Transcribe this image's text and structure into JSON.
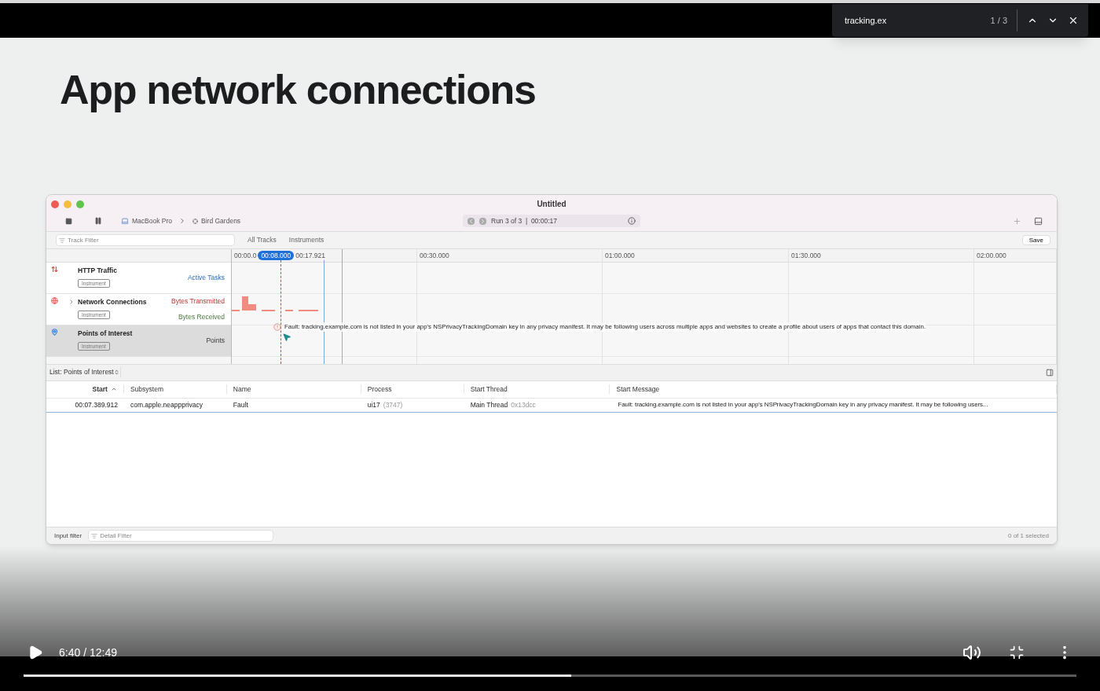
{
  "find_bar": {
    "query": "tracking.ex",
    "count": "1 / 3"
  },
  "slide": {
    "title": "App network connections",
    "window": {
      "title": "Untitled",
      "device": "MacBook Pro",
      "target": "Bird Gardens",
      "run": "Run 3 of 3  |  00:00:17",
      "track_filter": {
        "placeholder": "Track Filter"
      },
      "scopes": [
        "All Tracks",
        "Instruments"
      ],
      "save": "Save",
      "ruler": {
        "start": "00:00.0",
        "cursor": "00:08.000",
        "end": "00:17.921",
        "marks": [
          "00:30.000",
          "01:00.000",
          "01:30.000",
          "02:00.000"
        ]
      },
      "tracks": [
        {
          "name": "HTTP Traffic",
          "kind": "http",
          "badge": "Instrument",
          "expandable": false,
          "selected": false,
          "labels": [
            {
              "text": "Active Tasks",
              "kind": "tasks"
            }
          ]
        },
        {
          "name": "Network Connections",
          "kind": "network",
          "badge": "Instrument",
          "expandable": true,
          "selected": false,
          "labels": [
            {
              "text": "Bytes Transmitted",
              "kind": "transmitted"
            },
            {
              "text": "Bytes Received",
              "kind": "received"
            }
          ]
        },
        {
          "name": "Points of Interest",
          "kind": "poi",
          "badge": "Instrument",
          "expandable": false,
          "selected": true,
          "labels": [
            {
              "text": "Points",
              "kind": "points"
            }
          ]
        }
      ],
      "fault_message": "Fault: tracking.example.com is not listed in your app's NSPrivacyTrackingDomain key in any privacy manifest. It may be following users across multiple apps and websites to create a profile about users of apps that contact this domain.",
      "list": {
        "title": "List: Points of Interest",
        "columns": [
          {
            "label": "Start",
            "sorted": true
          },
          {
            "label": "Subsystem",
            "sorted": false
          },
          {
            "label": "Name",
            "sorted": false
          },
          {
            "label": "Process",
            "sorted": false
          },
          {
            "label": "Start Thread",
            "sorted": false
          },
          {
            "label": "Start Message",
            "sorted": false
          }
        ],
        "rows": [
          {
            "cells": [
              {
                "text": "00:07.389.912"
              },
              {
                "text": "com.apple.neappprivacy"
              },
              {
                "text": "Fault"
              },
              {
                "text": "ui17",
                "detail": "(3747)"
              },
              {
                "text": "Main Thread",
                "detail": "0x13dcc"
              },
              {
                "text": "Fault: tracking.example.com is not listed in your app's NSPrivacyTrackingDomain key in any privacy manifest. It may be following users..."
              }
            ]
          }
        ],
        "filter_label": "Input filter",
        "filter": {
          "placeholder": "Detail Filter"
        },
        "status": "0 of 1 selected"
      }
    }
  },
  "player": {
    "time": "6:40 / 12:49",
    "level": 0.52
  }
}
